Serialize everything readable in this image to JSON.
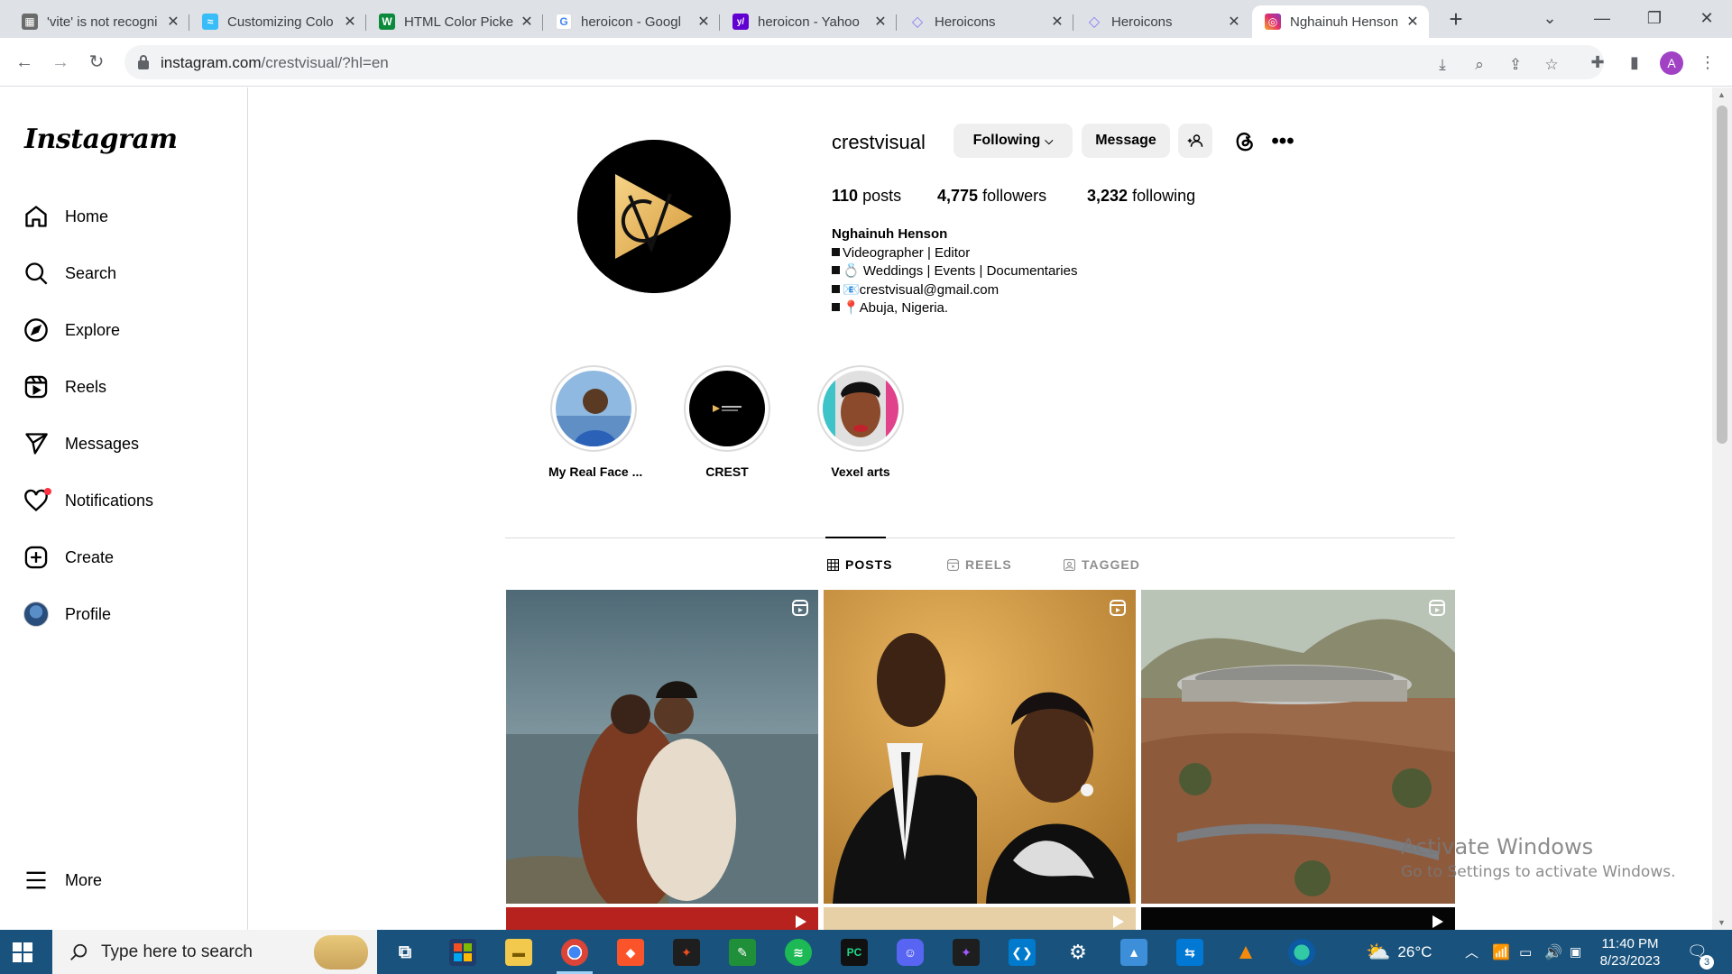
{
  "browser": {
    "tabs": [
      {
        "label": "'vite' is not recogni",
        "favicon_color": "#6b6b6b",
        "favicon_glyph": "▦"
      },
      {
        "label": "Customizing Colo",
        "favicon_color": "#38bdf8",
        "favicon_glyph": "≈"
      },
      {
        "label": "HTML Color Picke",
        "favicon_color": "#0a8a3a",
        "favicon_glyph": "W"
      },
      {
        "label": "heroicon - Googl",
        "favicon_color": "#4285f4",
        "favicon_glyph": "G"
      },
      {
        "label": "heroicon - Yahoo",
        "favicon_color": "#6001d2",
        "favicon_glyph": "y/"
      },
      {
        "label": "Heroicons",
        "favicon_color": "#8b7cf6",
        "favicon_glyph": "◇"
      },
      {
        "label": "Heroicons",
        "favicon_color": "#8b7cf6",
        "favicon_glyph": "◇"
      },
      {
        "label": "Nghainuh Henson",
        "favicon_color": "#e1306c",
        "favicon_glyph": "◎"
      }
    ],
    "url_host": "instagram.com",
    "url_path": "/crestvisual/?hl=en",
    "profile_initial": "A"
  },
  "sidebar": {
    "logo": "Instagram",
    "items": [
      {
        "label": "Home",
        "icon": "home-icon"
      },
      {
        "label": "Search",
        "icon": "search-icon"
      },
      {
        "label": "Explore",
        "icon": "explore-icon"
      },
      {
        "label": "Reels",
        "icon": "reels-icon"
      },
      {
        "label": "Messages",
        "icon": "messages-icon"
      },
      {
        "label": "Notifications",
        "icon": "heart-icon"
      },
      {
        "label": "Create",
        "icon": "plus-square-icon"
      },
      {
        "label": "Profile",
        "icon": "profile-avatar"
      }
    ],
    "more_label": "More"
  },
  "profile": {
    "username": "crestvisual",
    "following_label": "Following",
    "message_label": "Message",
    "posts_count": "110",
    "posts_label": "posts",
    "followers_count": "4,775",
    "followers_label": "followers",
    "following_count": "3,232",
    "following_stat_label": "following",
    "full_name": "Nghainuh Henson",
    "bio_lines": [
      "Videographer | Editor",
      "💍 Weddings | Events | Documentaries",
      "📧crestvisual@gmail.com",
      "📍Abuja, Nigeria."
    ],
    "accent": "#e8b85b"
  },
  "highlights": [
    {
      "label": "My Real Face ..."
    },
    {
      "label": "CREST"
    },
    {
      "label": "Vexel arts"
    }
  ],
  "content_tabs": [
    {
      "label": "POSTS",
      "active": true
    },
    {
      "label": "REELS",
      "active": false
    },
    {
      "label": "TAGGED",
      "active": false
    }
  ],
  "watermark": {
    "line1": "Activate Windows",
    "line2": "Go to Settings to activate Windows."
  },
  "taskbar": {
    "search_placeholder": "Type here to search",
    "weather": "26°C",
    "time": "11:40 PM",
    "date": "8/23/2023",
    "notification_count": "3"
  }
}
